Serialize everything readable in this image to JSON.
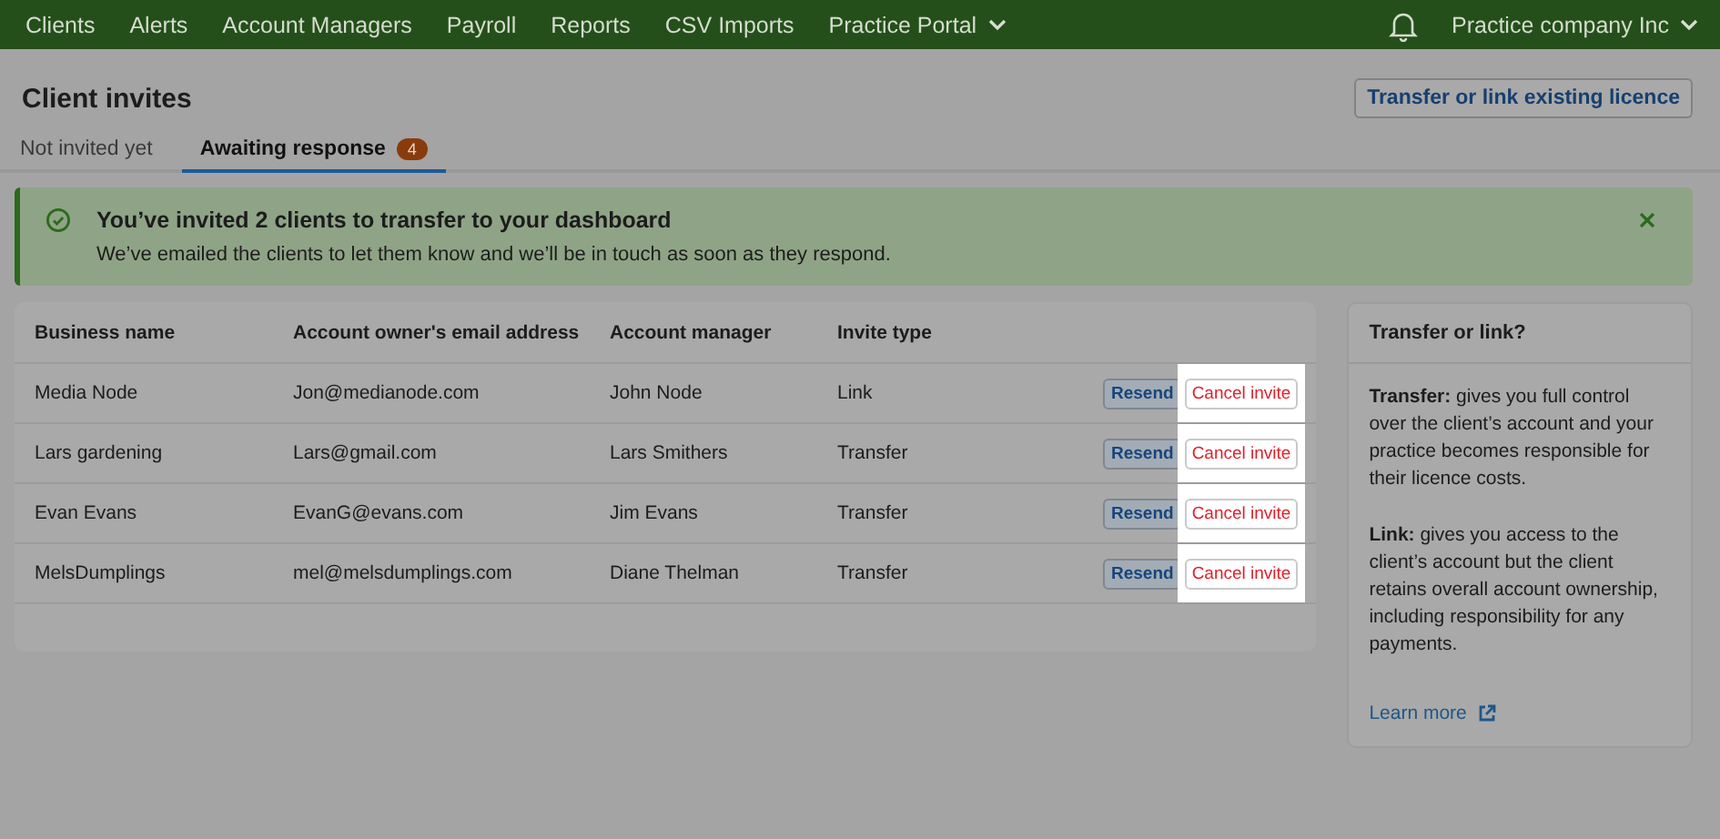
{
  "nav": {
    "items": [
      "Clients",
      "Alerts",
      "Account Managers",
      "Payroll",
      "Reports",
      "CSV Imports",
      {
        "label": "Practice Portal",
        "dropdown": true
      }
    ],
    "company": "Practice company Inc",
    "company_dropdown": true
  },
  "page": {
    "title": "Client invites",
    "action_button": "Transfer or link existing licence"
  },
  "tabs": [
    {
      "label": "Not invited yet",
      "selected": false
    },
    {
      "label": "Awaiting response",
      "selected": true,
      "count": "4"
    }
  ],
  "banner": {
    "title": "You’ve invited 2 clients to transfer to your dashboard",
    "message": "We’ve emailed the clients to let them know and we’ll be in touch as soon as they respond."
  },
  "table": {
    "columns": [
      "Business name",
      "Account owner's email address",
      "Account manager",
      "Invite type"
    ],
    "rows": [
      {
        "cells": [
          "Media Node",
          "Jon@medianode.com",
          "John Node",
          "Link"
        ],
        "actions": [
          {
            "label": "Resend",
            "kind": "resend",
            "highlighted": false
          },
          {
            "label": "Cancel invite",
            "kind": "cancel",
            "highlighted": true
          }
        ]
      },
      {
        "cells": [
          "Lars gardening",
          "Lars@gmail.com",
          "Lars Smithers",
          "Transfer"
        ],
        "actions": [
          {
            "label": "Resend",
            "kind": "resend",
            "highlighted": false
          },
          {
            "label": "Cancel invite",
            "kind": "cancel",
            "highlighted": true
          }
        ]
      },
      {
        "cells": [
          "Evan Evans",
          "EvanG@evans.com",
          "Jim Evans",
          "Transfer"
        ],
        "actions": [
          {
            "label": "Resend",
            "kind": "resend",
            "highlighted": false
          },
          {
            "label": "Cancel invite",
            "kind": "cancel",
            "highlighted": true
          }
        ]
      },
      {
        "cells": [
          "MelsDumplings",
          "mel@melsdumplings.com",
          "Diane Thelman",
          "Transfer"
        ],
        "actions": [
          {
            "label": "Resend",
            "kind": "resend",
            "highlighted": false
          },
          {
            "label": "Cancel invite",
            "kind": "cancel",
            "highlighted": true
          }
        ]
      }
    ]
  },
  "side_panel": {
    "title": "Transfer or link?",
    "paragraphs": [
      "**Transfer:** gives you full control over the client’s account and your practice becomes responsible for their licence costs.",
      "**Link:** gives you access to the client’s account but the client retains overall account ownership, including responsibility for any payments."
    ],
    "link": "Learn more"
  }
}
